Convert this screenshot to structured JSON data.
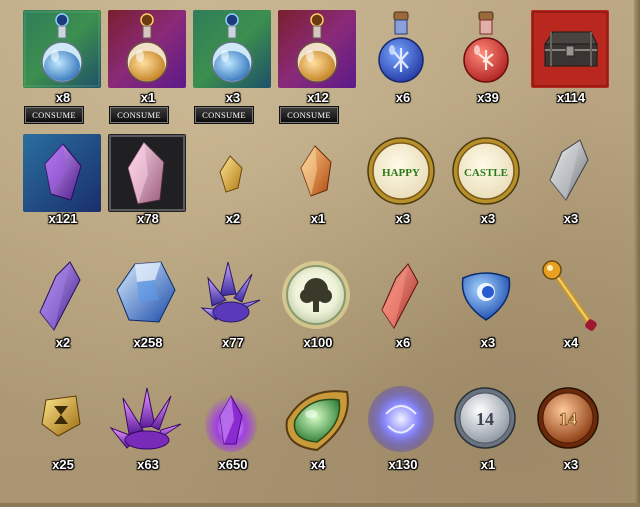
{
  "consume_label": "CONSUME",
  "coins": {
    "happy": "HAPPY",
    "castle": "CASTLE",
    "silver_number": "14",
    "bronze_number": "14"
  },
  "items": [
    {
      "name": "blue-potion-framed-icon",
      "count": "x8"
    },
    {
      "name": "orange-potion-framed-icon",
      "count": "x1"
    },
    {
      "name": "blue-potion-framed-icon",
      "count": "x3"
    },
    {
      "name": "orange-potion-framed-icon",
      "count": "x12"
    },
    {
      "name": "blue-rune-flask-icon",
      "count": "x6"
    },
    {
      "name": "red-rune-flask-icon",
      "count": "x39"
    },
    {
      "name": "treasure-chest-icon",
      "count": "x114"
    },
    {
      "name": "purple-crystal-framed-icon",
      "count": "x121"
    },
    {
      "name": "pink-crystal-framed-icon",
      "count": "x78"
    },
    {
      "name": "gold-shard-icon",
      "count": "x2"
    },
    {
      "name": "amber-shard-icon",
      "count": "x1"
    },
    {
      "name": "happy-coin-icon",
      "count": "x3"
    },
    {
      "name": "castle-coin-icon",
      "count": "x3"
    },
    {
      "name": "silver-shard-icon",
      "count": "x3"
    },
    {
      "name": "violet-crystal-icon",
      "count": "x2"
    },
    {
      "name": "blue-gem-icon",
      "count": "x258"
    },
    {
      "name": "crystal-cluster-icon",
      "count": "x77"
    },
    {
      "name": "glowing-orb-icon",
      "count": "x100"
    },
    {
      "name": "red-crystal-icon",
      "count": "x6"
    },
    {
      "name": "blue-emblem-icon",
      "count": "x3"
    },
    {
      "name": "scepter-icon",
      "count": "x4"
    },
    {
      "name": "gold-hourglass-badge-icon",
      "count": "x25"
    },
    {
      "name": "purple-crystal-cluster-icon",
      "count": "x63"
    },
    {
      "name": "purple-flame-crystal-icon",
      "count": "x650"
    },
    {
      "name": "green-gem-amulet-icon",
      "count": "x4"
    },
    {
      "name": "blue-energy-orb-icon",
      "count": "x130"
    },
    {
      "name": "silver-coin-14-icon",
      "count": "x1"
    },
    {
      "name": "bronze-coin-14-icon",
      "count": "x3"
    }
  ],
  "colors": {
    "background": "#b49f7c",
    "count_text": "#ffffff",
    "button_bg": "#1a1a1a"
  }
}
